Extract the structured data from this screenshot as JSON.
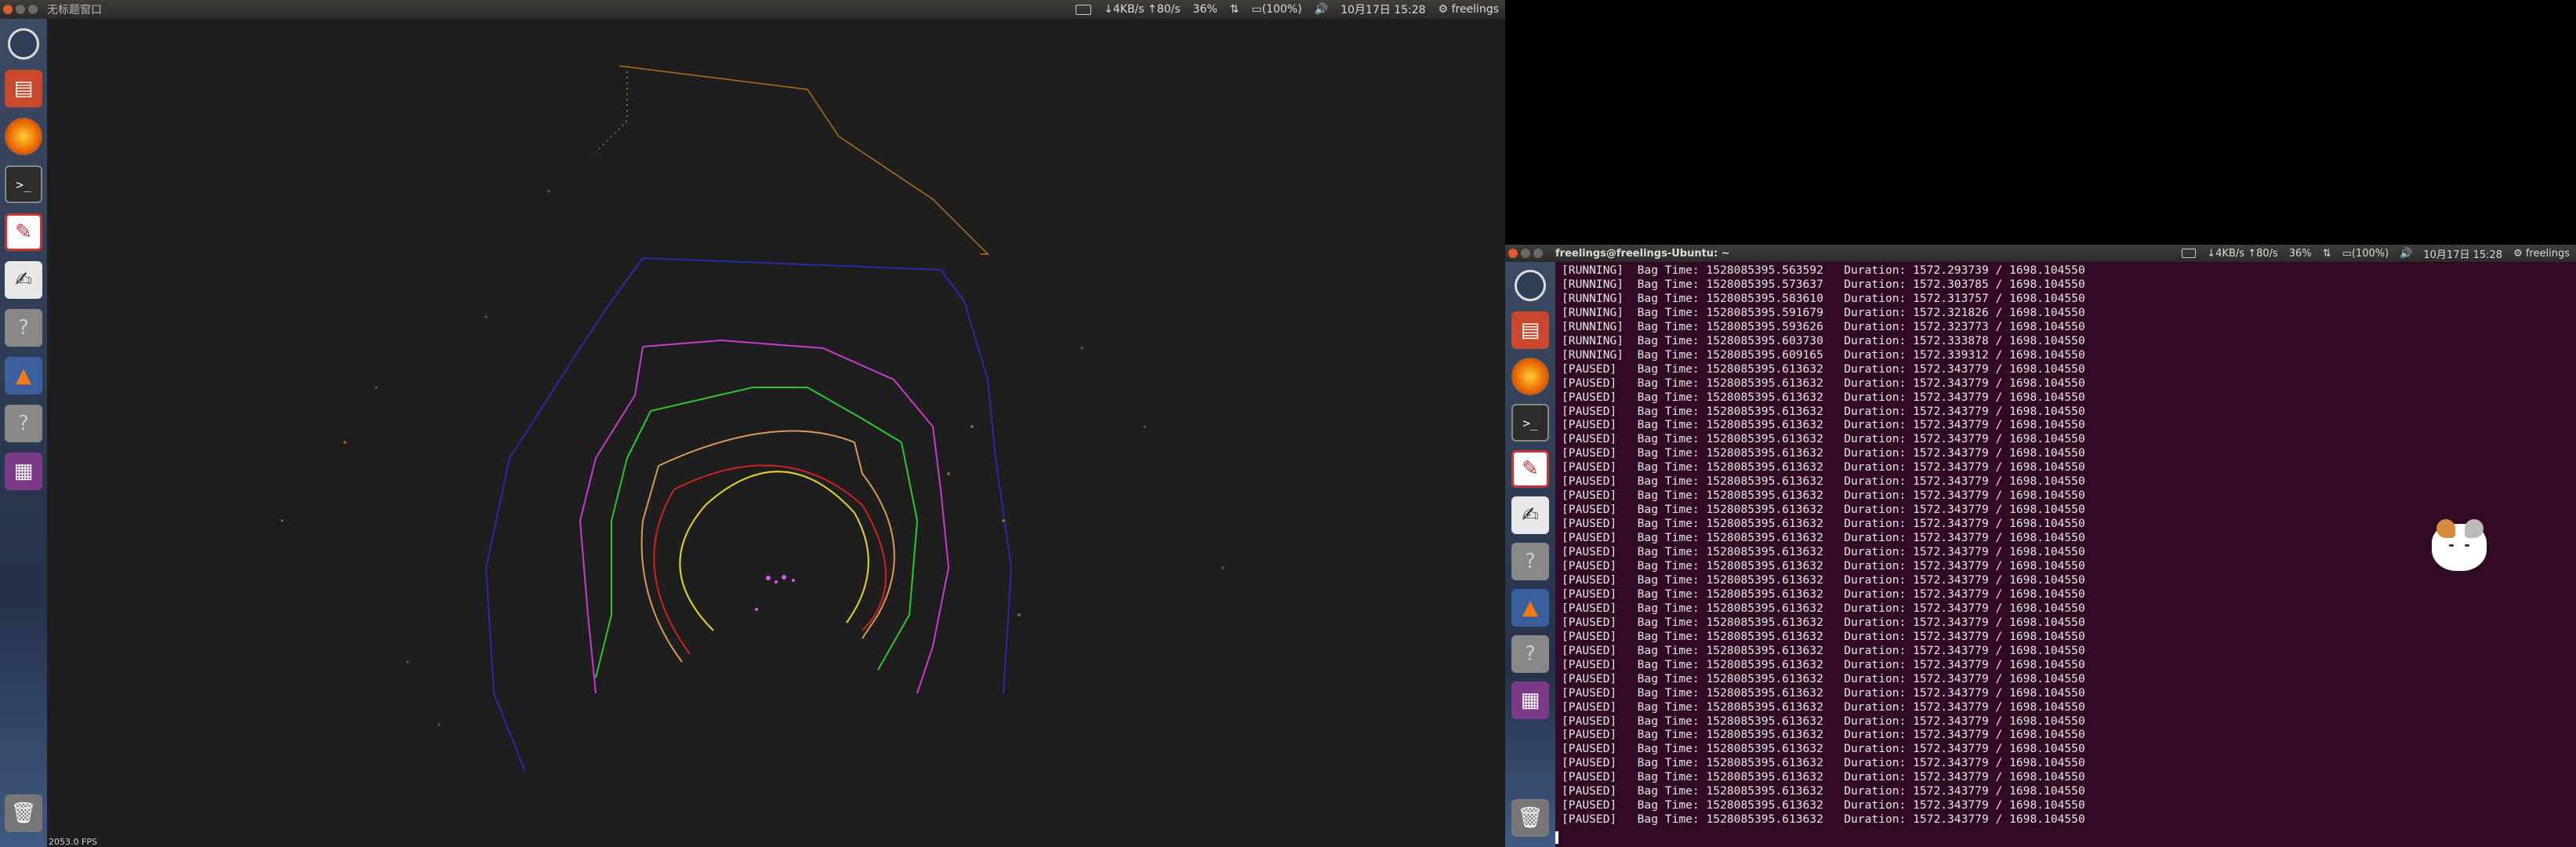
{
  "panel_left": {
    "window_title": "无标题窗口",
    "status": [
      "↓4KB/s ↑80/s",
      "36%",
      "(100%)",
      "10月17日 15:28",
      "freelings"
    ]
  },
  "panel_right": {
    "window_title": "freelings@freelings-Ubuntu: ~",
    "status": [
      "↓4KB/s ↑80/s",
      "36%",
      "(100%)",
      "10月17日 15:28",
      "freelings"
    ]
  },
  "launcher_icons": [
    "dash-icon",
    "files-icon",
    "firefox-icon",
    "terminal-icon",
    "text-editor-icon",
    "gedit-icon",
    "unknown-app-icon",
    "matlab-icon",
    "unknown-app-icon-2",
    "workspaces-icon"
  ],
  "viewer": {
    "fps": "2053.0 FPS"
  },
  "terminal": {
    "lines": [
      "[RUNNING]  Bag Time: 1528085395.563592   Duration: 1572.293739 / 1698.104550",
      "[RUNNING]  Bag Time: 1528085395.573637   Duration: 1572.303785 / 1698.104550",
      "[RUNNING]  Bag Time: 1528085395.583610   Duration: 1572.313757 / 1698.104550",
      "[RUNNING]  Bag Time: 1528085395.591679   Duration: 1572.321826 / 1698.104550",
      "[RUNNING]  Bag Time: 1528085395.593626   Duration: 1572.323773 / 1698.104550",
      "[RUNNING]  Bag Time: 1528085395.603730   Duration: 1572.333878 / 1698.104550",
      "[RUNNING]  Bag Time: 1528085395.609165   Duration: 1572.339312 / 1698.104550",
      "[PAUSED]   Bag Time: 1528085395.613632   Duration: 1572.343779 / 1698.104550",
      "[PAUSED]   Bag Time: 1528085395.613632   Duration: 1572.343779 / 1698.104550",
      "[PAUSED]   Bag Time: 1528085395.613632   Duration: 1572.343779 / 1698.104550",
      "[PAUSED]   Bag Time: 1528085395.613632   Duration: 1572.343779 / 1698.104550",
      "[PAUSED]   Bag Time: 1528085395.613632   Duration: 1572.343779 / 1698.104550",
      "[PAUSED]   Bag Time: 1528085395.613632   Duration: 1572.343779 / 1698.104550",
      "[PAUSED]   Bag Time: 1528085395.613632   Duration: 1572.343779 / 1698.104550",
      "[PAUSED]   Bag Time: 1528085395.613632   Duration: 1572.343779 / 1698.104550",
      "[PAUSED]   Bag Time: 1528085395.613632   Duration: 1572.343779 / 1698.104550",
      "[PAUSED]   Bag Time: 1528085395.613632   Duration: 1572.343779 / 1698.104550",
      "[PAUSED]   Bag Time: 1528085395.613632   Duration: 1572.343779 / 1698.104550",
      "[PAUSED]   Bag Time: 1528085395.613632   Duration: 1572.343779 / 1698.104550",
      "[PAUSED]   Bag Time: 1528085395.613632   Duration: 1572.343779 / 1698.104550",
      "[PAUSED]   Bag Time: 1528085395.613632   Duration: 1572.343779 / 1698.104550",
      "[PAUSED]   Bag Time: 1528085395.613632   Duration: 1572.343779 / 1698.104550",
      "[PAUSED]   Bag Time: 1528085395.613632   Duration: 1572.343779 / 1698.104550",
      "[PAUSED]   Bag Time: 1528085395.613632   Duration: 1572.343779 / 1698.104550",
      "[PAUSED]   Bag Time: 1528085395.613632   Duration: 1572.343779 / 1698.104550",
      "[PAUSED]   Bag Time: 1528085395.613632   Duration: 1572.343779 / 1698.104550",
      "[PAUSED]   Bag Time: 1528085395.613632   Duration: 1572.343779 / 1698.104550",
      "[PAUSED]   Bag Time: 1528085395.613632   Duration: 1572.343779 / 1698.104550",
      "[PAUSED]   Bag Time: 1528085395.613632   Duration: 1572.343779 / 1698.104550",
      "[PAUSED]   Bag Time: 1528085395.613632   Duration: 1572.343779 / 1698.104550",
      "[PAUSED]   Bag Time: 1528085395.613632   Duration: 1572.343779 / 1698.104550",
      "[PAUSED]   Bag Time: 1528085395.613632   Duration: 1572.343779 / 1698.104550",
      "[PAUSED]   Bag Time: 1528085395.613632   Duration: 1572.343779 / 1698.104550",
      "[PAUSED]   Bag Time: 1528085395.613632   Duration: 1572.343779 / 1698.104550",
      "[PAUSED]   Bag Time: 1528085395.613632   Duration: 1572.343779 / 1698.104550",
      "[PAUSED]   Bag Time: 1528085395.613632   Duration: 1572.343779 / 1698.104550",
      "[PAUSED]   Bag Time: 1528085395.613632   Duration: 1572.343779 / 1698.104550",
      "[PAUSED]   Bag Time: 1528085395.613632   Duration: 1572.343779 / 1698.104550",
      "[PAUSED]   Bag Time: 1528085395.613632   Duration: 1572.343779 / 1698.104550",
      "[PAUSED]   Bag Time: 1528085395.613632   Duration: 1572.343779 / 1698.104550"
    ]
  }
}
